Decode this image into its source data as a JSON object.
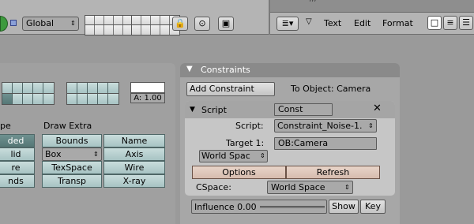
{
  "header": {
    "orientation": "Global",
    "text_title": "///",
    "menu": [
      "Text",
      "Edit",
      "Format"
    ]
  },
  "left": {
    "alpha_label": "A: 1.00",
    "draw_type_partial": "pe",
    "draw_extra_label": "Draw Extra",
    "draw_type_buttons": [
      "ded",
      "lid",
      "re",
      "nds"
    ],
    "draw_extra": {
      "bounds": "Bounds",
      "name": "Name",
      "box": "Box",
      "axis": "Axis",
      "texspace": "TexSpace",
      "wire": "Wire",
      "transp": "Transp",
      "xray": "X-ray"
    }
  },
  "constraints": {
    "title": "Constraints",
    "add_button": "Add Constraint",
    "to_object": "To Object: Camera",
    "item": {
      "type": "Script",
      "name": "Const",
      "script_label": "Script:",
      "script_value": "Constraint_Noise-1.",
      "target_label": "Target 1:",
      "target_value": "OB:Camera",
      "target_space": "World Spac",
      "options_button": "Options",
      "refresh_button": "Refresh",
      "cspace_label": "CSpace:",
      "cspace_value": "World Space"
    },
    "influence_label": "Influence 0.00",
    "show_button": "Show",
    "key_button": "Key"
  }
}
